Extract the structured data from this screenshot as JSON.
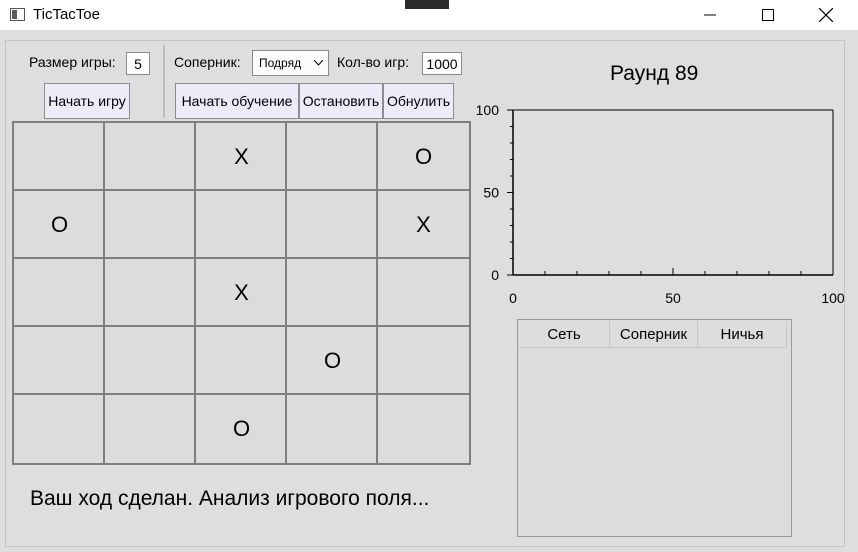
{
  "window": {
    "title": "TicTacToe",
    "minimize_icon": "minimize-icon",
    "maximize_icon": "maximize-icon",
    "close_icon": "close-icon"
  },
  "controls": {
    "size_label": "Размер игры:",
    "size_value": "5",
    "start_game_label": "Начать игру",
    "opponent_label": "Соперник:",
    "opponent_value": "Подряд",
    "games_label": "Кол-во игр:",
    "games_value": "1000",
    "start_training_label": "Начать обучение",
    "stop_label": "Остановить",
    "reset_label": "Обнулить"
  },
  "board": {
    "cells": [
      [
        "",
        "",
        "X",
        "",
        "O"
      ],
      [
        "O",
        "",
        "",
        "",
        "X"
      ],
      [
        "",
        "",
        "X",
        "",
        ""
      ],
      [
        "",
        "",
        "",
        "O",
        ""
      ],
      [
        "",
        "",
        "O",
        "",
        ""
      ]
    ]
  },
  "status": "Ваш ход сделан. Анализ игрового поля...",
  "round_title": "Раунд 89",
  "chart_data": {
    "type": "line",
    "series": [],
    "xlim": [
      0,
      100
    ],
    "ylim": [
      0,
      100
    ],
    "x_ticks": [
      "0",
      "50",
      "100"
    ],
    "y_ticks": [
      "0",
      "50",
      "100"
    ],
    "grid": false
  },
  "stats_table": {
    "columns": [
      "Сеть",
      "Соперник",
      "Ничья"
    ],
    "rows": []
  },
  "colors": {
    "background": "#dedede",
    "button_fill": "#ececf8",
    "cell_border": "#7f7f7f"
  }
}
